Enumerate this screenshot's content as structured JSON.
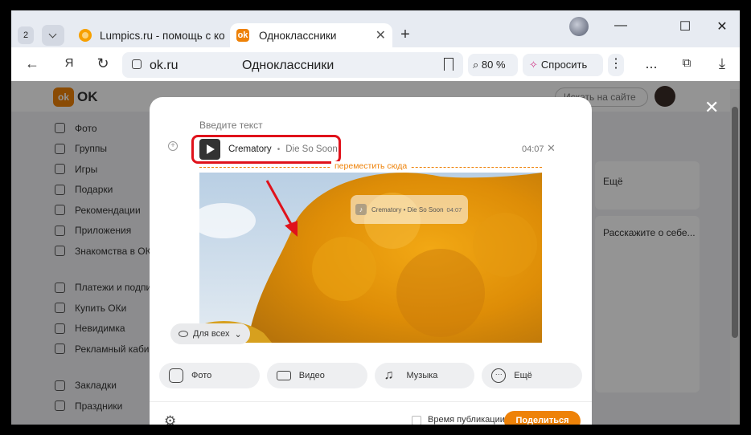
{
  "browser": {
    "tab_count": "2",
    "tabs": [
      {
        "label": "Lumpics.ru - помощь с ком",
        "active": false
      },
      {
        "label": "Одноклассники",
        "active": true
      }
    ],
    "url": "ok.ru",
    "page_title": "Одноклассники",
    "zoom": "80 %",
    "ask_label": "Спросить",
    "menu_label": "⋮",
    "more_label": "..."
  },
  "ok": {
    "logo": "OK",
    "search_placeholder": "Искать на сайте",
    "nav": [
      "Фото",
      "Группы",
      "Игры",
      "Подарки",
      "Рекомендации",
      "Приложения",
      "Знакомства в ОК",
      "Платежи и подписки",
      "Купить ОКи",
      "Невидимка",
      "Рекламный кабинет",
      "Закладки",
      "Праздники"
    ],
    "right_more": "Ещё",
    "right_about": "Расскажите о себе..."
  },
  "composer": {
    "placeholder": "Введите текст",
    "track": {
      "artist": "Crematory",
      "separator": "•",
      "title": "Die So Soon",
      "duration": "04:07"
    },
    "drop_hint": "переместить сюда",
    "privacy": "Для всех",
    "actions": [
      "Фото",
      "Видео",
      "Музыка",
      "Ещё"
    ],
    "publish_time": "Время публикации",
    "share": "Поделиться"
  },
  "colors": {
    "accent": "#ee8208",
    "highlight": "#e0121b"
  }
}
